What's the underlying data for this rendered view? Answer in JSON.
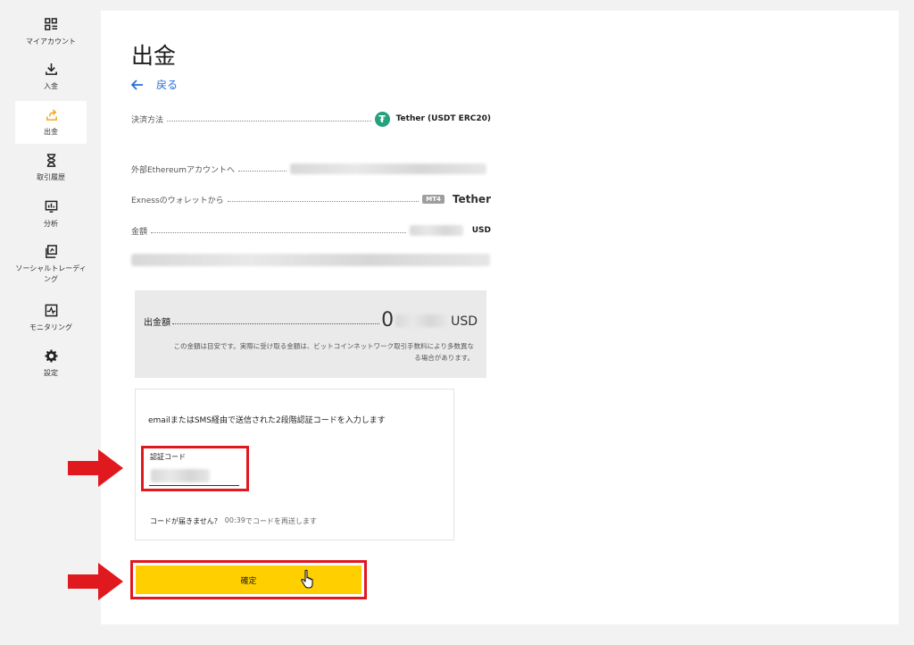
{
  "sidebar": {
    "items": [
      {
        "label": "マイアカウント",
        "icon": "dashboard-icon"
      },
      {
        "label": "入金",
        "icon": "download-icon"
      },
      {
        "label": "出金",
        "icon": "upload-icon"
      },
      {
        "label": "取引履歴",
        "icon": "hourglass-icon"
      },
      {
        "label": "分析",
        "icon": "analytics-icon"
      },
      {
        "label": "ソーシャルトレーディング",
        "icon": "social-trading-icon"
      },
      {
        "label": "モニタリング",
        "icon": "monitoring-icon"
      },
      {
        "label": "設定",
        "icon": "gear-icon"
      }
    ],
    "active_index": 2
  },
  "page": {
    "title": "出金",
    "back_label": "戻る"
  },
  "details": {
    "payment_method_label": "決済方法",
    "payment_method_value": "Tether (USDT ERC20)",
    "destination_label": "外部Ethereumアカウントへ",
    "source_label": "Exnessのウォレットから",
    "source_badge": "MT4",
    "source_value": "Tether",
    "amount_label": "金額",
    "amount_unit": "USD"
  },
  "summary": {
    "label": "出金額",
    "amount_prefix": "0",
    "unit": "USD",
    "note": "この金額は目安です。実際に受け取る金額は、ビットコインネットワーク取引手数料により多数異なる場合があります。"
  },
  "verification": {
    "instruction": "emailまたはSMS経由で送信された2段階認証コードを入力します",
    "code_label": "認証コード",
    "no_code_text": "コードが届きません？",
    "timer": "00:39",
    "resend_text": "でコードを再送します"
  },
  "confirm": {
    "label": "確定"
  },
  "colors": {
    "accent": "#ffcf00",
    "link": "#2a6fd6",
    "highlight": "#e0191f",
    "tether": "#26a17b"
  }
}
